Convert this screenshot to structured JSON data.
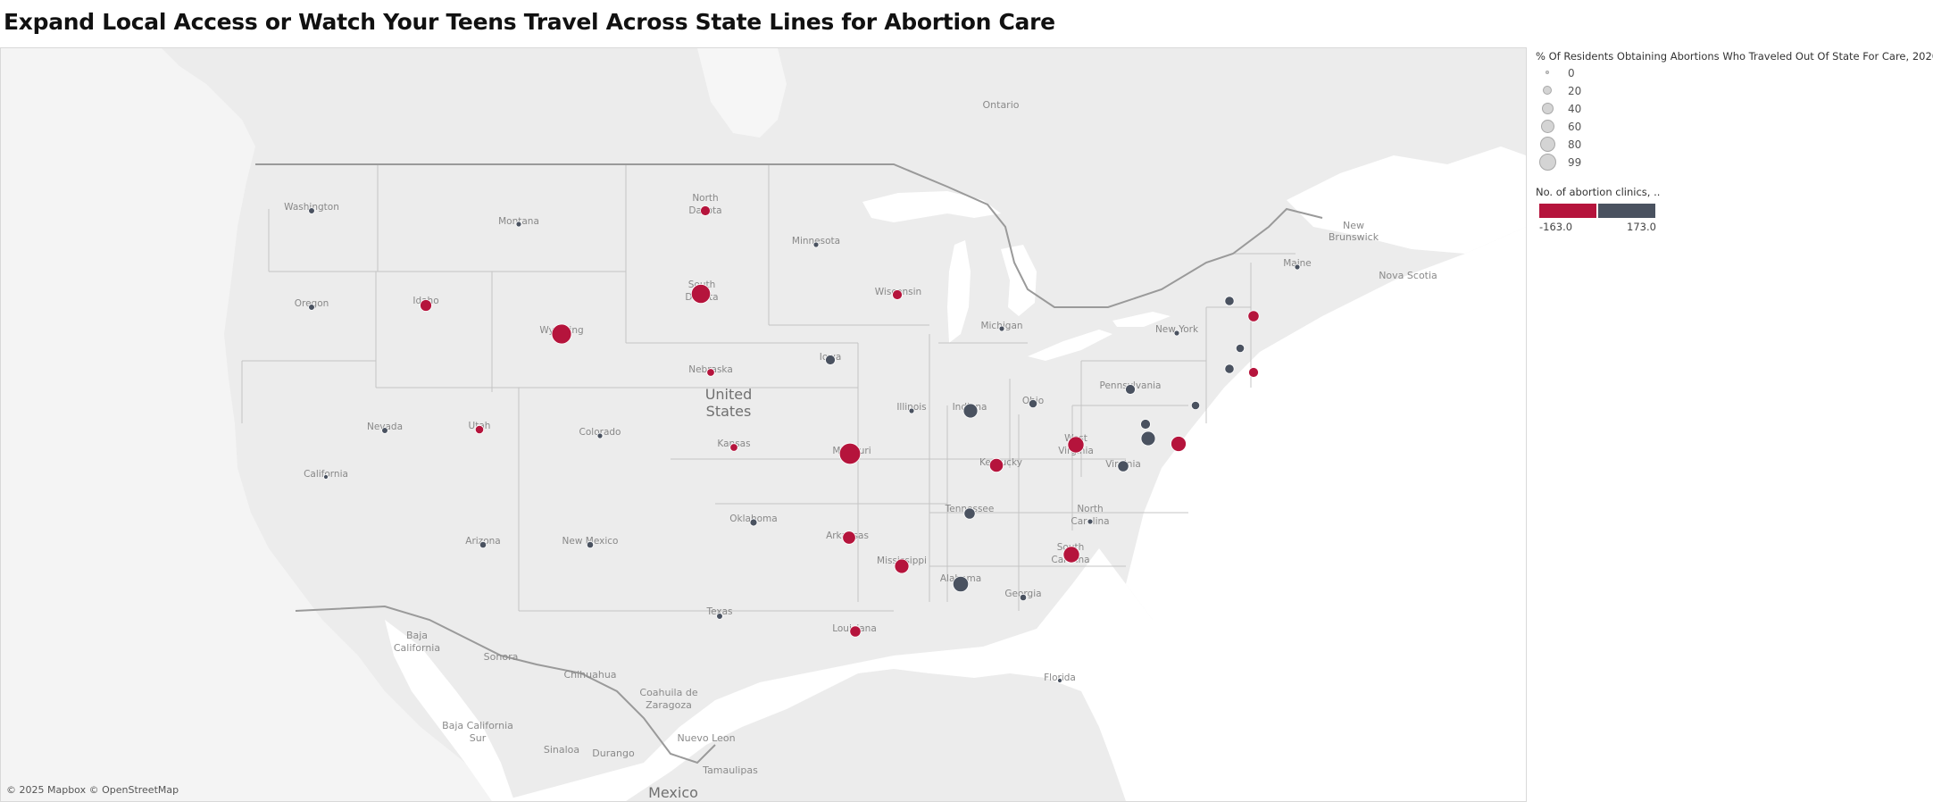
{
  "title": "Expand Local Access or Watch Your Teens Travel Across State Lines for Abortion Care",
  "attribution": "© 2025 Mapbox © OpenStreetMap",
  "colors": {
    "negative": "#b5143c",
    "positive": "#4a5260",
    "land": "#ececec",
    "water": "#ffffff",
    "border": "#c4c4c4"
  },
  "size_legend": {
    "title": "% Of Residents Obtaining Abortions Who Traveled Out Of State For Care, 2020",
    "items": [
      "0",
      "20",
      "40",
      "60",
      "80",
      "99"
    ]
  },
  "color_legend": {
    "title": "No. of abortion clinics, ..",
    "min_label": "-163.0",
    "max_label": "173.0"
  },
  "labels": {
    "country": [
      "United",
      "States"
    ],
    "mexico": "Mexico",
    "ontario": "Ontario",
    "new_brunswick": [
      "New",
      "Brunswick"
    ],
    "nova_scotia": "Nova Scotia",
    "sonora": "Sonora",
    "chihuahua": "Chihuahua",
    "coahuila": [
      "Coahuila de",
      "Zaragoza"
    ],
    "nuevo_leon": "Nuevo Leon",
    "tamaulipas": "Tamaulipas",
    "sinaloa": "Sinaloa",
    "durango": "Durango",
    "baja_california": [
      "Baja",
      "California"
    ],
    "baja_california_sur": [
      "Baja California",
      "Sur"
    ],
    "states": {
      "washington": "Washington",
      "montana": "Montana",
      "north_dakota": [
        "North",
        "Dakota"
      ],
      "minnesota": "Minnesota",
      "oregon": "Oregon",
      "idaho": "Idaho",
      "south_dakota": [
        "South",
        "Dakota"
      ],
      "wisconsin": "Wisconsin",
      "michigan": "Michigan",
      "wyoming": "Wyoming",
      "iowa": "Iowa",
      "nebraska": "Nebraska",
      "new_york": "New York",
      "maine": "Maine",
      "pennsylvania": "Pennsylvania",
      "nevada": "Nevada",
      "utah": "Utah",
      "colorado": "Colorado",
      "illinois": "Illinois",
      "indiana": "Indiana",
      "ohio": "Ohio",
      "california": "California",
      "kansas": "Kansas",
      "missouri": "Missouri",
      "kentucky": "Kentucky",
      "west_virginia": [
        "West",
        "Virginia"
      ],
      "virginia": "Virginia",
      "tennessee": "Tennessee",
      "north_carolina": [
        "North",
        "Carolina"
      ],
      "oklahoma": "Oklahoma",
      "arizona": "Arizona",
      "new_mexico": "New Mexico",
      "arkansas": "Arkansas",
      "south_carolina": [
        "South",
        "Carolina"
      ],
      "mississippi": "Mississippi",
      "alabama": "Alabama",
      "georgia": "Georgia",
      "texas": "Texas",
      "louisiana": "Louisiana",
      "florida": "Florida"
    }
  },
  "chart_data": {
    "type": "map",
    "size_measure": "% Of Residents Obtaining Abortions Who Traveled Out Of State For Care, 2020",
    "color_measure": "No. of abortion clinics, ..",
    "color_range": [
      -163.0,
      173.0
    ],
    "points": [
      {
        "state": "Wyoming",
        "pct": 62,
        "sign": "negative"
      },
      {
        "state": "South Dakota",
        "pct": 58,
        "sign": "negative"
      },
      {
        "state": "Missouri",
        "pct": 72,
        "sign": "negative"
      },
      {
        "state": "West Virginia",
        "pct": 40,
        "sign": "negative"
      },
      {
        "state": "South Carolina",
        "pct": 40,
        "sign": "negative"
      },
      {
        "state": "Delaware",
        "pct": 34,
        "sign": "negative"
      },
      {
        "state": "Alabama",
        "pct": 36,
        "sign": "positive"
      },
      {
        "state": "Indiana",
        "pct": 30,
        "sign": "positive"
      },
      {
        "state": "Maryland",
        "pct": 30,
        "sign": "positive"
      },
      {
        "state": "Mississippi",
        "pct": 30,
        "sign": "negative"
      },
      {
        "state": "Kentucky",
        "pct": 27,
        "sign": "negative"
      },
      {
        "state": "Arkansas",
        "pct": 24,
        "sign": "negative"
      },
      {
        "state": "Idaho",
        "pct": 18,
        "sign": "negative"
      },
      {
        "state": "New Hampshire",
        "pct": 16,
        "sign": "negative"
      },
      {
        "state": "Tennessee",
        "pct": 16,
        "sign": "positive"
      },
      {
        "state": "Virginia",
        "pct": 16,
        "sign": "positive"
      },
      {
        "state": "Louisiana",
        "pct": 16,
        "sign": "negative"
      },
      {
        "state": "Wisconsin",
        "pct": 12,
        "sign": "negative"
      },
      {
        "state": "Iowa",
        "pct": 12,
        "sign": "positive"
      },
      {
        "state": "North Dakota",
        "pct": 12,
        "sign": "negative"
      },
      {
        "state": "Pennsylvania",
        "pct": 12,
        "sign": "positive"
      },
      {
        "state": "Rhode Island",
        "pct": 12,
        "sign": "negative"
      },
      {
        "state": "Washington DC",
        "pct": 12,
        "sign": "positive"
      },
      {
        "state": "Utah",
        "pct": 8,
        "sign": "negative"
      },
      {
        "state": "Kansas",
        "pct": 6,
        "sign": "negative"
      },
      {
        "state": "Nebraska",
        "pct": 6,
        "sign": "negative"
      },
      {
        "state": "Ohio",
        "pct": 8,
        "sign": "positive"
      },
      {
        "state": "Vermont",
        "pct": 10,
        "sign": "positive"
      },
      {
        "state": "Massachusetts",
        "pct": 8,
        "sign": "positive"
      },
      {
        "state": "Connecticut",
        "pct": 10,
        "sign": "positive"
      },
      {
        "state": "New Jersey",
        "pct": 8,
        "sign": "positive"
      },
      {
        "state": "Washington",
        "pct": 3,
        "sign": "positive"
      },
      {
        "state": "Oregon",
        "pct": 3,
        "sign": "positive"
      },
      {
        "state": "Montana",
        "pct": 2,
        "sign": "positive"
      },
      {
        "state": "Minnesota",
        "pct": 2,
        "sign": "positive"
      },
      {
        "state": "Nevada",
        "pct": 3,
        "sign": "positive"
      },
      {
        "state": "Colorado",
        "pct": 2,
        "sign": "positive"
      },
      {
        "state": "California",
        "pct": 1,
        "sign": "positive"
      },
      {
        "state": "Illinois",
        "pct": 2,
        "sign": "positive"
      },
      {
        "state": "Michigan",
        "pct": 2,
        "sign": "positive"
      },
      {
        "state": "New York",
        "pct": 2,
        "sign": "positive"
      },
      {
        "state": "Maine",
        "pct": 2,
        "sign": "positive"
      },
      {
        "state": "Oklahoma",
        "pct": 5,
        "sign": "positive"
      },
      {
        "state": "Arizona",
        "pct": 4,
        "sign": "positive"
      },
      {
        "state": "New Mexico",
        "pct": 4,
        "sign": "positive"
      },
      {
        "state": "Texas",
        "pct": 3,
        "sign": "positive"
      },
      {
        "state": "Georgia",
        "pct": 4,
        "sign": "positive"
      },
      {
        "state": "North Carolina",
        "pct": 2,
        "sign": "positive"
      },
      {
        "state": "Florida",
        "pct": 1,
        "sign": "positive"
      }
    ]
  }
}
